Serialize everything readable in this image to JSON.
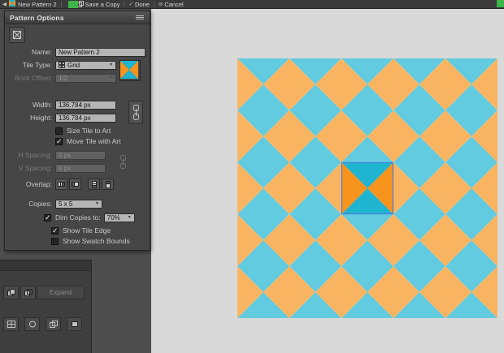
{
  "top_bar": {
    "pattern_name": "New Pattern 2",
    "save_copy_label": "Save a Copy",
    "done_label": "Done",
    "cancel_label": "Cancel"
  },
  "panel": {
    "title": "Pattern Options",
    "fields": {
      "name": {
        "label": "Name:",
        "value": "New Pattern 2"
      },
      "tile_type": {
        "label": "Tile Type:",
        "value": "Grid"
      },
      "brick_offset": {
        "label": "Brick Offset:",
        "value": "1/2"
      },
      "width": {
        "label": "Width:",
        "value": "136.784 px"
      },
      "height": {
        "label": "Height:",
        "value": "136.784 px"
      },
      "size_tile_to_art": {
        "label": "Size Tile to Art",
        "checked": false
      },
      "move_tile_with_art": {
        "label": "Move Tile with Art",
        "checked": true
      },
      "h_spacing": {
        "label": "H Spacing:",
        "value": "0 px"
      },
      "v_spacing": {
        "label": "V Spacing:",
        "value": "0 px"
      },
      "overlap": {
        "label": "Overlap:"
      },
      "copies": {
        "label": "Copies:",
        "value": "5 x 5"
      },
      "dim_copies": {
        "label": "Dim Copies to:",
        "value": "70%",
        "checked": true
      },
      "show_tile_edge": {
        "label": "Show Tile Edge",
        "checked": true
      },
      "show_swatch_bounds": {
        "label": "Show Swatch Bounds",
        "checked": false
      }
    }
  },
  "bottom_panel": {
    "expand_label": "Expand"
  },
  "pattern": {
    "colors": {
      "orange": "#F7941E",
      "cyan": "#1FB5D1",
      "tile_edge": "#4A7CDC",
      "artwork_green": "#3FB549"
    }
  },
  "icons": {
    "back": "◀",
    "dropdown": "▼",
    "check": "✓",
    "cancel": "⊘"
  }
}
